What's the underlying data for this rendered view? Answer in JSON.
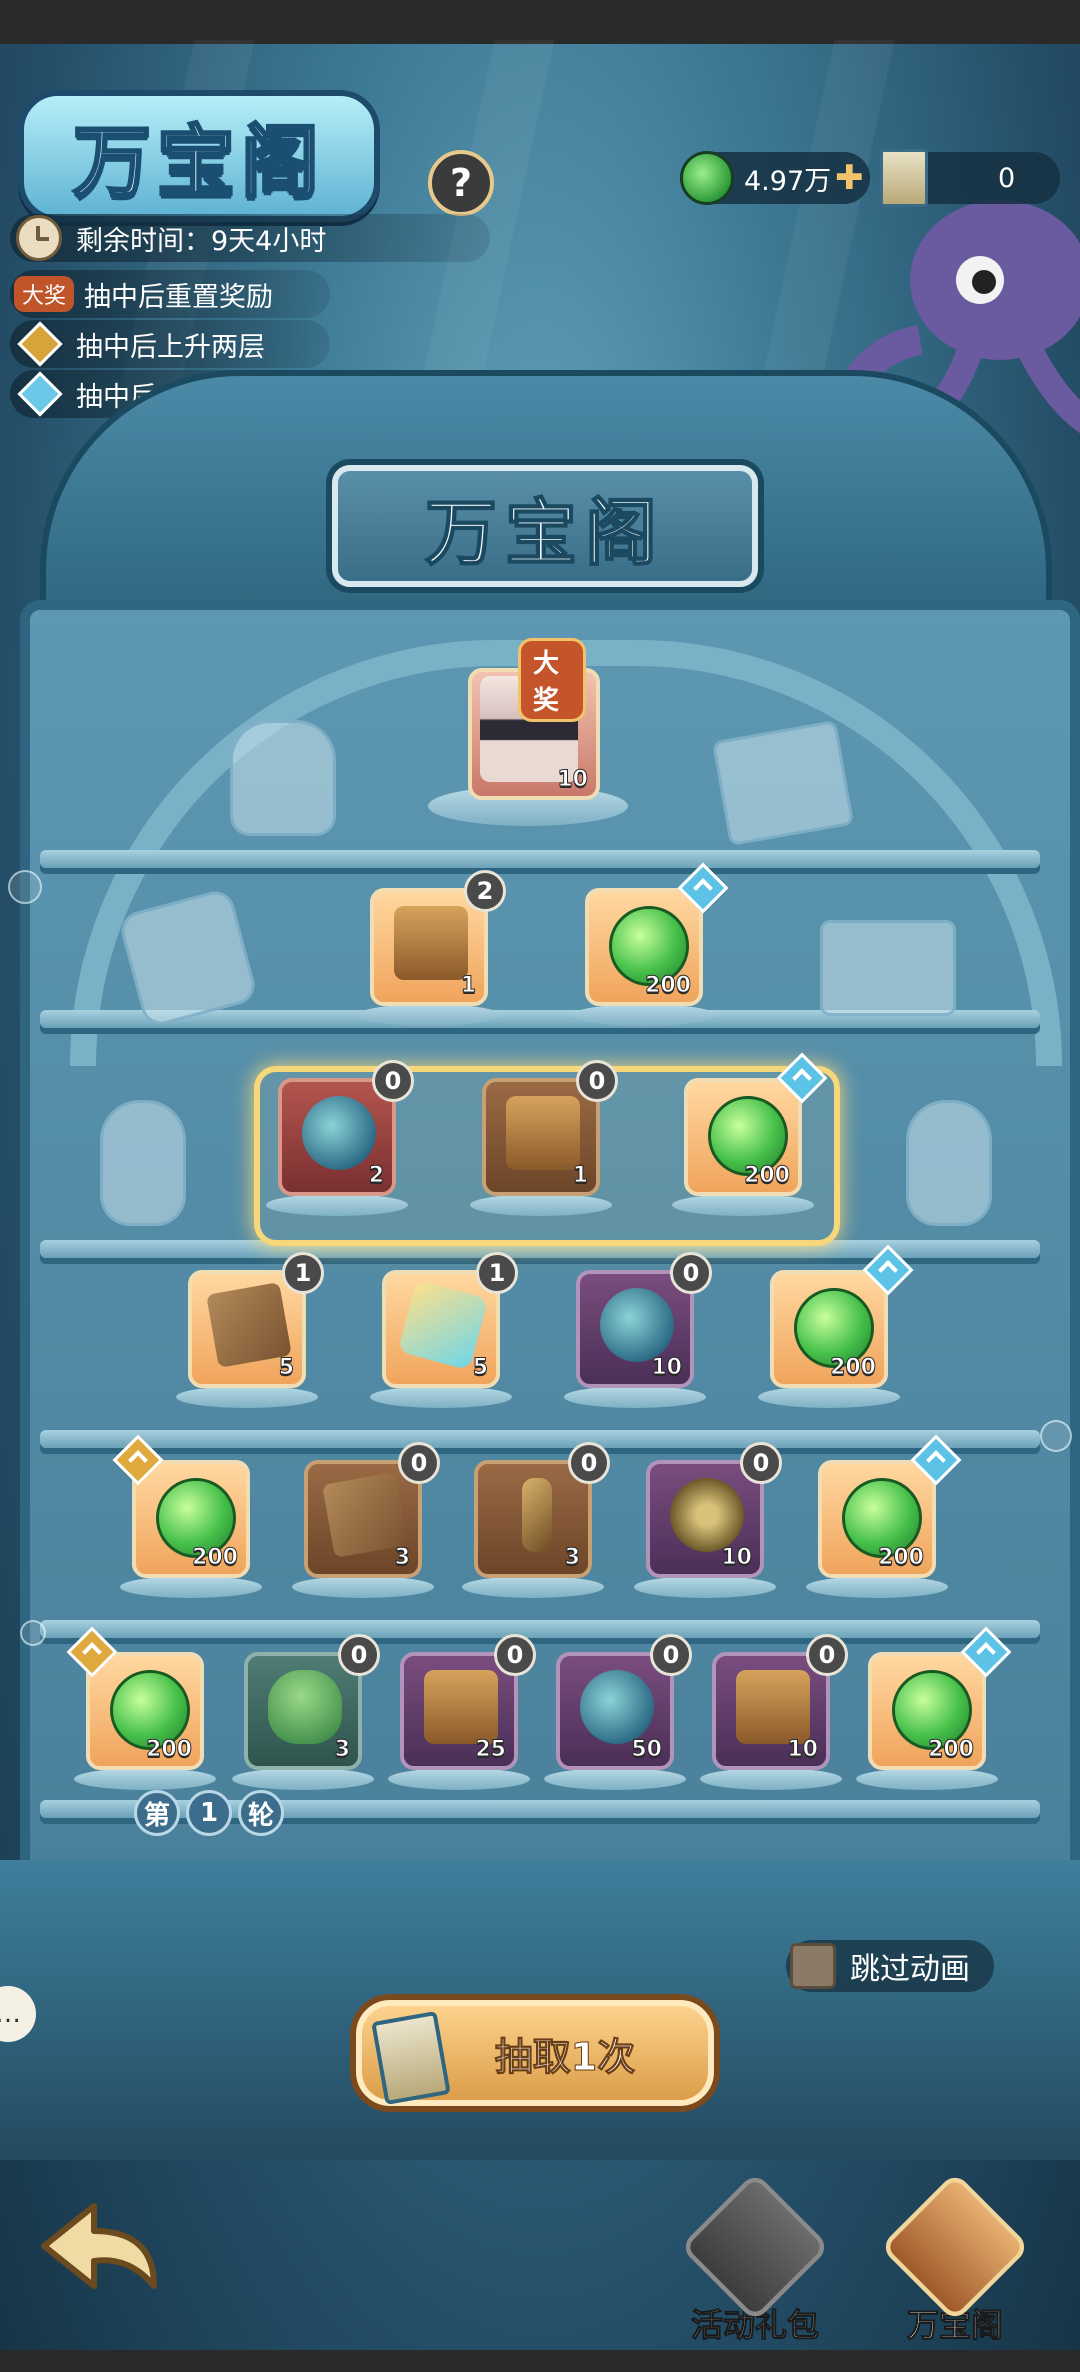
{
  "header": {
    "logo_text": "万宝阁",
    "help_label": "?",
    "remaining_time": "剩余时间：9天4小时",
    "legend": [
      {
        "tag": "大奖",
        "text": "抽中后重置奖励"
      },
      {
        "marker": "gold-up-diamond",
        "text": "抽中后上升两层"
      },
      {
        "marker": "blue-up-diamond",
        "text": "抽中后上升一层"
      }
    ]
  },
  "currency": {
    "jade_amount": "4.97万",
    "ticket_amount": "0"
  },
  "sign": {
    "title": "万宝阁"
  },
  "grand_prize": {
    "tag": "大奖",
    "qty": "10"
  },
  "rows": [
    [
      {
        "icon": "mystery-chest-icon",
        "qty": "1",
        "count": "2"
      },
      {
        "icon": "jade-icon",
        "qty": "200",
        "up": "blue"
      }
    ],
    [
      {
        "icon": "green-orb-icon",
        "qty": "2",
        "count": "0"
      },
      {
        "icon": "treasure-chest-icon",
        "qty": "1",
        "count": "0"
      },
      {
        "icon": "jade-icon",
        "qty": "200",
        "up": "blue"
      }
    ],
    [
      {
        "icon": "golden-tablet-icon",
        "qty": "5",
        "count": "1"
      },
      {
        "icon": "crystal-icon",
        "qty": "5",
        "count": "1"
      },
      {
        "icon": "crystal-ball-icon",
        "qty": "10",
        "count": "0"
      },
      {
        "icon": "jade-icon",
        "qty": "200",
        "up": "blue"
      }
    ],
    [
      {
        "icon": "jade-icon",
        "qty": "200",
        "up": "gold"
      },
      {
        "icon": "scroll-icon",
        "qty": "3",
        "count": "0"
      },
      {
        "icon": "staff-icon",
        "qty": "3",
        "count": "0"
      },
      {
        "icon": "yin-yang-disk-icon",
        "qty": "10",
        "count": "0"
      },
      {
        "icon": "jade-icon",
        "qty": "200",
        "up": "blue"
      }
    ],
    [
      {
        "icon": "jade-icon",
        "qty": "200",
        "up": "gold"
      },
      {
        "icon": "egg-icon",
        "qty": "3",
        "count": "0"
      },
      {
        "icon": "gem-chest-icon",
        "qty": "25",
        "count": "0"
      },
      {
        "icon": "sprout-orb-icon",
        "qty": "50",
        "count": "0"
      },
      {
        "icon": "flame-chest-icon",
        "qty": "10",
        "count": "0"
      },
      {
        "icon": "jade-icon",
        "qty": "200",
        "up": "blue"
      }
    ]
  ],
  "round": {
    "prefix": "第",
    "number": "1",
    "suffix": "轮"
  },
  "skip_animation": {
    "label": "跳过动画",
    "checked": false
  },
  "draw_button": {
    "label": "抽取1次"
  },
  "bottom_nav": {
    "tabs": [
      {
        "label": "活动礼包",
        "active": false
      },
      {
        "label": "万宝阁",
        "active": true
      }
    ]
  }
}
